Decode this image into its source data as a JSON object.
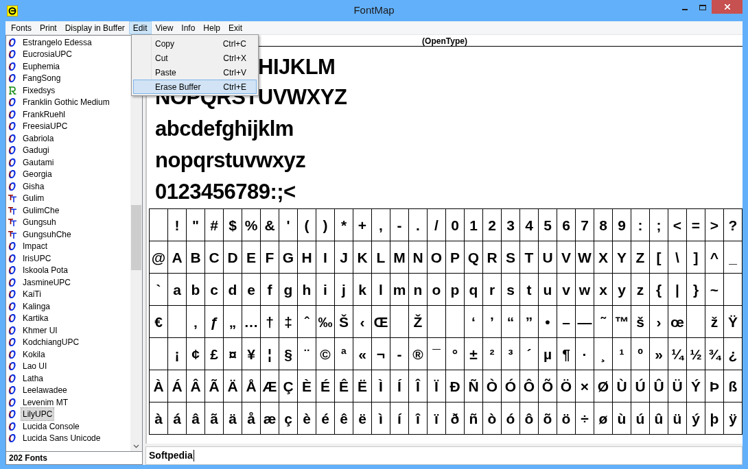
{
  "window": {
    "title": "FontMap"
  },
  "menu_bar": [
    {
      "label": "Fonts",
      "selected": false
    },
    {
      "label": "Print",
      "selected": false
    },
    {
      "label": "Display in Buffer",
      "selected": false
    },
    {
      "label": "Edit",
      "selected": true
    },
    {
      "label": "View",
      "selected": false
    },
    {
      "label": "Info",
      "selected": false
    },
    {
      "label": "Help",
      "selected": false
    },
    {
      "label": "Exit",
      "selected": false
    }
  ],
  "edit_menu": [
    {
      "label": "Copy",
      "shortcut": "Ctrl+C",
      "selected": false
    },
    {
      "label": "Cut",
      "shortcut": "Ctrl+X",
      "selected": false
    },
    {
      "label": "Paste",
      "shortcut": "Ctrl+V",
      "selected": false
    },
    {
      "label": "Erase Buffer",
      "shortcut": "Ctrl+E",
      "selected": true
    }
  ],
  "font_list": [
    {
      "name": "Estrangelo Edessa",
      "kind": "opentype",
      "selected": false
    },
    {
      "name": "EucrosiaUPC",
      "kind": "opentype",
      "selected": false
    },
    {
      "name": "Euphemia",
      "kind": "opentype",
      "selected": false
    },
    {
      "name": "FangSong",
      "kind": "opentype",
      "selected": false
    },
    {
      "name": "Fixedsys",
      "kind": "raster",
      "selected": false
    },
    {
      "name": "Franklin Gothic Medium",
      "kind": "opentype",
      "selected": false
    },
    {
      "name": "FrankRuehl",
      "kind": "opentype",
      "selected": false
    },
    {
      "name": "FreesiaUPC",
      "kind": "opentype",
      "selected": false
    },
    {
      "name": "Gabriola",
      "kind": "opentype",
      "selected": false
    },
    {
      "name": "Gadugi",
      "kind": "opentype",
      "selected": false
    },
    {
      "name": "Gautami",
      "kind": "opentype",
      "selected": false
    },
    {
      "name": "Georgia",
      "kind": "opentype",
      "selected": false
    },
    {
      "name": "Gisha",
      "kind": "opentype",
      "selected": false
    },
    {
      "name": "Gulim",
      "kind": "truetype",
      "selected": false
    },
    {
      "name": "GulimChe",
      "kind": "truetype",
      "selected": false
    },
    {
      "name": "Gungsuh",
      "kind": "truetype",
      "selected": false
    },
    {
      "name": "GungsuhChe",
      "kind": "truetype",
      "selected": false
    },
    {
      "name": "Impact",
      "kind": "opentype",
      "selected": false
    },
    {
      "name": "IrisUPC",
      "kind": "opentype",
      "selected": false
    },
    {
      "name": "Iskoola Pota",
      "kind": "opentype",
      "selected": false
    },
    {
      "name": "JasmineUPC",
      "kind": "opentype",
      "selected": false
    },
    {
      "name": "KaiTi",
      "kind": "opentype",
      "selected": false
    },
    {
      "name": "Kalinga",
      "kind": "opentype",
      "selected": false
    },
    {
      "name": "Kartika",
      "kind": "opentype",
      "selected": false
    },
    {
      "name": "Khmer UI",
      "kind": "opentype",
      "selected": false
    },
    {
      "name": "KodchiangUPC",
      "kind": "opentype",
      "selected": false
    },
    {
      "name": "Kokila",
      "kind": "opentype",
      "selected": false
    },
    {
      "name": "Lao UI",
      "kind": "opentype",
      "selected": false
    },
    {
      "name": "Latha",
      "kind": "opentype",
      "selected": false
    },
    {
      "name": "Leelawadee",
      "kind": "opentype",
      "selected": false
    },
    {
      "name": "Levenim MT",
      "kind": "opentype",
      "selected": false
    },
    {
      "name": "LilyUPC",
      "kind": "opentype",
      "selected": true
    },
    {
      "name": "Lucida Console",
      "kind": "opentype",
      "selected": false
    },
    {
      "name": "Lucida Sans Unicode",
      "kind": "opentype",
      "selected": false
    }
  ],
  "font_count": "202 Fonts",
  "preview": {
    "header": "(OpenType)",
    "lines": [
      "HIJKLM",
      "NOPQRSTUVWXYZ",
      "abcdefghijklm",
      "nopqrstuvwxyz",
      "0123456789:;<"
    ]
  },
  "char_grid": [
    [
      {
        "kind": "blank"
      },
      {
        "kind": "glyph",
        "text": "!"
      },
      {
        "kind": "glyph",
        "text": "\""
      },
      {
        "kind": "glyph",
        "text": "#"
      },
      {
        "kind": "glyph",
        "text": "$"
      },
      {
        "kind": "glyph",
        "text": "%"
      },
      {
        "kind": "glyph",
        "text": "&"
      },
      {
        "kind": "glyph",
        "text": "'"
      },
      {
        "kind": "glyph",
        "text": "("
      },
      {
        "kind": "glyph",
        "text": ")"
      },
      {
        "kind": "glyph",
        "text": "*"
      },
      {
        "kind": "glyph",
        "text": "+"
      },
      {
        "kind": "glyph",
        "text": ","
      },
      {
        "kind": "glyph",
        "text": "-"
      },
      {
        "kind": "glyph",
        "text": "."
      },
      {
        "kind": "glyph",
        "text": "/"
      },
      {
        "kind": "glyph",
        "text": "0"
      },
      {
        "kind": "glyph",
        "text": "1"
      },
      {
        "kind": "glyph",
        "text": "2"
      },
      {
        "kind": "glyph",
        "text": "3"
      },
      {
        "kind": "glyph",
        "text": "4"
      },
      {
        "kind": "glyph",
        "text": "5"
      },
      {
        "kind": "glyph",
        "text": "6"
      },
      {
        "kind": "glyph",
        "text": "7"
      },
      {
        "kind": "glyph",
        "text": "8"
      },
      {
        "kind": "glyph",
        "text": "9"
      },
      {
        "kind": "glyph",
        "text": ":"
      },
      {
        "kind": "glyph",
        "text": ";"
      },
      {
        "kind": "glyph",
        "text": "<"
      },
      {
        "kind": "glyph",
        "text": "="
      },
      {
        "kind": "glyph",
        "text": ">"
      },
      {
        "kind": "glyph",
        "text": "?"
      }
    ],
    [
      {
        "kind": "glyph",
        "text": "@"
      },
      {
        "kind": "glyph",
        "text": "A"
      },
      {
        "kind": "glyph",
        "text": "B"
      },
      {
        "kind": "glyph",
        "text": "C"
      },
      {
        "kind": "glyph",
        "text": "D"
      },
      {
        "kind": "glyph",
        "text": "E"
      },
      {
        "kind": "glyph",
        "text": "F"
      },
      {
        "kind": "glyph",
        "text": "G"
      },
      {
        "kind": "glyph",
        "text": "H"
      },
      {
        "kind": "glyph",
        "text": "I"
      },
      {
        "kind": "glyph",
        "text": "J"
      },
      {
        "kind": "glyph",
        "text": "K"
      },
      {
        "kind": "glyph",
        "text": "L"
      },
      {
        "kind": "glyph",
        "text": "M"
      },
      {
        "kind": "glyph",
        "text": "N"
      },
      {
        "kind": "glyph",
        "text": "O"
      },
      {
        "kind": "glyph",
        "text": "P"
      },
      {
        "kind": "glyph",
        "text": "Q"
      },
      {
        "kind": "glyph",
        "text": "R"
      },
      {
        "kind": "glyph",
        "text": "S"
      },
      {
        "kind": "glyph",
        "text": "T"
      },
      {
        "kind": "glyph",
        "text": "U"
      },
      {
        "kind": "glyph",
        "text": "V"
      },
      {
        "kind": "glyph",
        "text": "W"
      },
      {
        "kind": "glyph",
        "text": "X"
      },
      {
        "kind": "glyph",
        "text": "Y"
      },
      {
        "kind": "glyph",
        "text": "Z"
      },
      {
        "kind": "glyph",
        "text": "["
      },
      {
        "kind": "glyph",
        "text": "\\"
      },
      {
        "kind": "glyph",
        "text": "]"
      },
      {
        "kind": "glyph",
        "text": "^"
      },
      {
        "kind": "glyph",
        "text": "_"
      }
    ],
    [
      {
        "kind": "glyph",
        "text": "`"
      },
      {
        "kind": "glyph",
        "text": "a"
      },
      {
        "kind": "glyph",
        "text": "b"
      },
      {
        "kind": "glyph",
        "text": "c"
      },
      {
        "kind": "glyph",
        "text": "d"
      },
      {
        "kind": "glyph",
        "text": "e"
      },
      {
        "kind": "glyph",
        "text": "f"
      },
      {
        "kind": "glyph",
        "text": "g"
      },
      {
        "kind": "glyph",
        "text": "h"
      },
      {
        "kind": "glyph",
        "text": "i"
      },
      {
        "kind": "glyph",
        "text": "j"
      },
      {
        "kind": "glyph",
        "text": "k"
      },
      {
        "kind": "glyph",
        "text": "l"
      },
      {
        "kind": "glyph",
        "text": "m"
      },
      {
        "kind": "glyph",
        "text": "n"
      },
      {
        "kind": "glyph",
        "text": "o"
      },
      {
        "kind": "glyph",
        "text": "p"
      },
      {
        "kind": "glyph",
        "text": "q"
      },
      {
        "kind": "glyph",
        "text": "r"
      },
      {
        "kind": "glyph",
        "text": "s"
      },
      {
        "kind": "glyph",
        "text": "t"
      },
      {
        "kind": "glyph",
        "text": "u"
      },
      {
        "kind": "glyph",
        "text": "v"
      },
      {
        "kind": "glyph",
        "text": "w"
      },
      {
        "kind": "glyph",
        "text": "x"
      },
      {
        "kind": "glyph",
        "text": "y"
      },
      {
        "kind": "glyph",
        "text": "z"
      },
      {
        "kind": "glyph",
        "text": "{"
      },
      {
        "kind": "glyph",
        "text": "|"
      },
      {
        "kind": "glyph",
        "text": "}"
      },
      {
        "kind": "glyph",
        "text": "~"
      },
      {
        "kind": "blank"
      }
    ],
    [
      {
        "kind": "glyph",
        "text": "€"
      },
      {
        "kind": "blank"
      },
      {
        "kind": "glyph",
        "text": "‚"
      },
      {
        "kind": "glyph",
        "text": "ƒ"
      },
      {
        "kind": "glyph",
        "text": "„"
      },
      {
        "kind": "glyph",
        "text": "…"
      },
      {
        "kind": "glyph",
        "text": "†"
      },
      {
        "kind": "glyph",
        "text": "‡"
      },
      {
        "kind": "glyph",
        "text": "ˆ"
      },
      {
        "kind": "glyph",
        "text": "‰"
      },
      {
        "kind": "glyph",
        "text": "Š"
      },
      {
        "kind": "glyph",
        "text": "‹"
      },
      {
        "kind": "glyph",
        "text": "Œ"
      },
      {
        "kind": "blank"
      },
      {
        "kind": "glyph",
        "text": "Ž"
      },
      {
        "kind": "blank"
      },
      {
        "kind": "blank"
      },
      {
        "kind": "glyph",
        "text": "‘"
      },
      {
        "kind": "glyph",
        "text": "’"
      },
      {
        "kind": "glyph",
        "text": "“"
      },
      {
        "kind": "glyph",
        "text": "”"
      },
      {
        "kind": "glyph",
        "text": "•"
      },
      {
        "kind": "glyph",
        "text": "–"
      },
      {
        "kind": "glyph",
        "text": "—"
      },
      {
        "kind": "glyph",
        "text": "˜"
      },
      {
        "kind": "glyph",
        "text": "™"
      },
      {
        "kind": "glyph",
        "text": "š"
      },
      {
        "kind": "glyph",
        "text": "›"
      },
      {
        "kind": "glyph",
        "text": "œ"
      },
      {
        "kind": "blank"
      },
      {
        "kind": "glyph",
        "text": "ž"
      },
      {
        "kind": "glyph",
        "text": "Ÿ"
      }
    ],
    [
      {
        "kind": "blank"
      },
      {
        "kind": "glyph",
        "text": "¡"
      },
      {
        "kind": "glyph",
        "text": "¢"
      },
      {
        "kind": "glyph",
        "text": "£"
      },
      {
        "kind": "glyph",
        "text": "¤"
      },
      {
        "kind": "glyph",
        "text": "¥"
      },
      {
        "kind": "glyph",
        "text": "¦"
      },
      {
        "kind": "glyph",
        "text": "§"
      },
      {
        "kind": "glyph",
        "text": "¨"
      },
      {
        "kind": "glyph",
        "text": "©"
      },
      {
        "kind": "glyph",
        "text": "ª"
      },
      {
        "kind": "glyph",
        "text": "«"
      },
      {
        "kind": "glyph",
        "text": "¬"
      },
      {
        "kind": "glyph",
        "text": "-"
      },
      {
        "kind": "glyph",
        "text": "®"
      },
      {
        "kind": "glyph",
        "text": "¯"
      },
      {
        "kind": "glyph",
        "text": "°"
      },
      {
        "kind": "glyph",
        "text": "±"
      },
      {
        "kind": "glyph",
        "text": "²"
      },
      {
        "kind": "glyph",
        "text": "³"
      },
      {
        "kind": "glyph",
        "text": "´"
      },
      {
        "kind": "glyph",
        "text": "µ"
      },
      {
        "kind": "glyph",
        "text": "¶"
      },
      {
        "kind": "glyph",
        "text": "·"
      },
      {
        "kind": "glyph",
        "text": "¸"
      },
      {
        "kind": "glyph",
        "text": "¹"
      },
      {
        "kind": "glyph",
        "text": "º"
      },
      {
        "kind": "glyph",
        "text": "»"
      },
      {
        "kind": "glyph",
        "text": "¼"
      },
      {
        "kind": "glyph",
        "text": "½"
      },
      {
        "kind": "glyph",
        "text": "¾"
      },
      {
        "kind": "glyph",
        "text": "¿"
      }
    ],
    [
      {
        "kind": "glyph",
        "text": "À"
      },
      {
        "kind": "glyph",
        "text": "Á"
      },
      {
        "kind": "glyph",
        "text": "Â"
      },
      {
        "kind": "glyph",
        "text": "Ã"
      },
      {
        "kind": "glyph",
        "text": "Ä"
      },
      {
        "kind": "glyph",
        "text": "Å"
      },
      {
        "kind": "glyph",
        "text": "Æ"
      },
      {
        "kind": "glyph",
        "text": "Ç"
      },
      {
        "kind": "glyph",
        "text": "È"
      },
      {
        "kind": "glyph",
        "text": "É"
      },
      {
        "kind": "glyph",
        "text": "Ê"
      },
      {
        "kind": "glyph",
        "text": "Ë"
      },
      {
        "kind": "glyph",
        "text": "Ì"
      },
      {
        "kind": "glyph",
        "text": "Í"
      },
      {
        "kind": "glyph",
        "text": "Î"
      },
      {
        "kind": "glyph",
        "text": "Ï"
      },
      {
        "kind": "glyph",
        "text": "Ð"
      },
      {
        "kind": "glyph",
        "text": "Ñ"
      },
      {
        "kind": "glyph",
        "text": "Ò"
      },
      {
        "kind": "glyph",
        "text": "Ó"
      },
      {
        "kind": "glyph",
        "text": "Ô"
      },
      {
        "kind": "glyph",
        "text": "Õ"
      },
      {
        "kind": "glyph",
        "text": "Ö"
      },
      {
        "kind": "glyph",
        "text": "×"
      },
      {
        "kind": "glyph",
        "text": "Ø"
      },
      {
        "kind": "glyph",
        "text": "Ù"
      },
      {
        "kind": "glyph",
        "text": "Ú"
      },
      {
        "kind": "glyph",
        "text": "Û"
      },
      {
        "kind": "glyph",
        "text": "Ü"
      },
      {
        "kind": "glyph",
        "text": "Ý"
      },
      {
        "kind": "glyph",
        "text": "Þ"
      },
      {
        "kind": "glyph",
        "text": "ß"
      }
    ],
    [
      {
        "kind": "glyph",
        "text": "à"
      },
      {
        "kind": "glyph",
        "text": "á"
      },
      {
        "kind": "glyph",
        "text": "â"
      },
      {
        "kind": "glyph",
        "text": "ã"
      },
      {
        "kind": "glyph",
        "text": "ä"
      },
      {
        "kind": "glyph",
        "text": "å"
      },
      {
        "kind": "glyph",
        "text": "æ"
      },
      {
        "kind": "glyph",
        "text": "ç"
      },
      {
        "kind": "glyph",
        "text": "è"
      },
      {
        "kind": "glyph",
        "text": "é"
      },
      {
        "kind": "glyph",
        "text": "ê"
      },
      {
        "kind": "glyph",
        "text": "ë"
      },
      {
        "kind": "glyph",
        "text": "ì"
      },
      {
        "kind": "glyph",
        "text": "í"
      },
      {
        "kind": "glyph",
        "text": "î"
      },
      {
        "kind": "glyph",
        "text": "ï"
      },
      {
        "kind": "glyph",
        "text": "ð"
      },
      {
        "kind": "glyph",
        "text": "ñ"
      },
      {
        "kind": "glyph",
        "text": "ò"
      },
      {
        "kind": "glyph",
        "text": "ó"
      },
      {
        "kind": "glyph",
        "text": "ô"
      },
      {
        "kind": "glyph",
        "text": "õ"
      },
      {
        "kind": "glyph",
        "text": "ö"
      },
      {
        "kind": "glyph",
        "text": "÷"
      },
      {
        "kind": "glyph",
        "text": "ø"
      },
      {
        "kind": "glyph",
        "text": "ù"
      },
      {
        "kind": "glyph",
        "text": "ú"
      },
      {
        "kind": "glyph",
        "text": "û"
      },
      {
        "kind": "glyph",
        "text": "ü"
      },
      {
        "kind": "glyph",
        "text": "ý"
      },
      {
        "kind": "glyph",
        "text": "þ"
      },
      {
        "kind": "glyph",
        "text": "ÿ"
      }
    ]
  ],
  "buffer": {
    "value": "Softpedia"
  }
}
